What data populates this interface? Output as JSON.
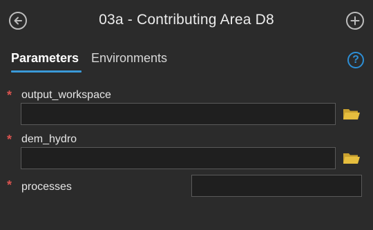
{
  "header": {
    "title": "03a - Contributing Area D8",
    "back_icon": "arrow-left-circle-icon",
    "add_icon": "plus-circle-icon"
  },
  "tabs": [
    {
      "label": "Parameters",
      "active": true
    },
    {
      "label": "Environments",
      "active": false
    }
  ],
  "help": {
    "glyph": "?",
    "icon": "help-icon"
  },
  "parameters": [
    {
      "label": "output_workspace",
      "required_mark": "*",
      "value": "",
      "browse_icon": "folder-icon"
    },
    {
      "label": "dem_hydro",
      "required_mark": "*",
      "value": "",
      "browse_icon": "folder-icon"
    },
    {
      "label": "processes",
      "required_mark": "*",
      "value": ""
    }
  ],
  "colors": {
    "background": "#2b2b2b",
    "accent": "#3a9ad9",
    "required": "#d9534f",
    "folder": "#e0b63a"
  }
}
